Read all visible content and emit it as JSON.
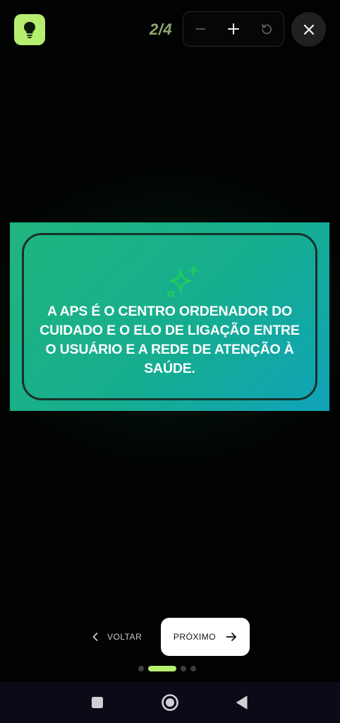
{
  "header": {
    "page_counter": "2/4",
    "icons": {
      "hint": "lightbulb-icon",
      "zoom_out": "minus-icon",
      "zoom_in": "plus-icon",
      "reset": "rotate-ccw-icon",
      "close": "close-icon"
    }
  },
  "card": {
    "icon": "sparkles-icon",
    "text": "A APS É O CENTRO ORDENADOR DO CUIDADO E O ELO DE LIGAÇÃO ENTRE O USUÁRIO E A REDE DE ATENÇÃO À SAÚDE."
  },
  "navigation": {
    "back_label": "VOLTAR",
    "next_label": "PRÓXIMO",
    "total_pages": 4,
    "current_page": 2
  },
  "colors": {
    "accent": "#b6ee6e",
    "card_start": "#20b57e",
    "card_end": "#0fa3b9",
    "background": "#010302"
  }
}
